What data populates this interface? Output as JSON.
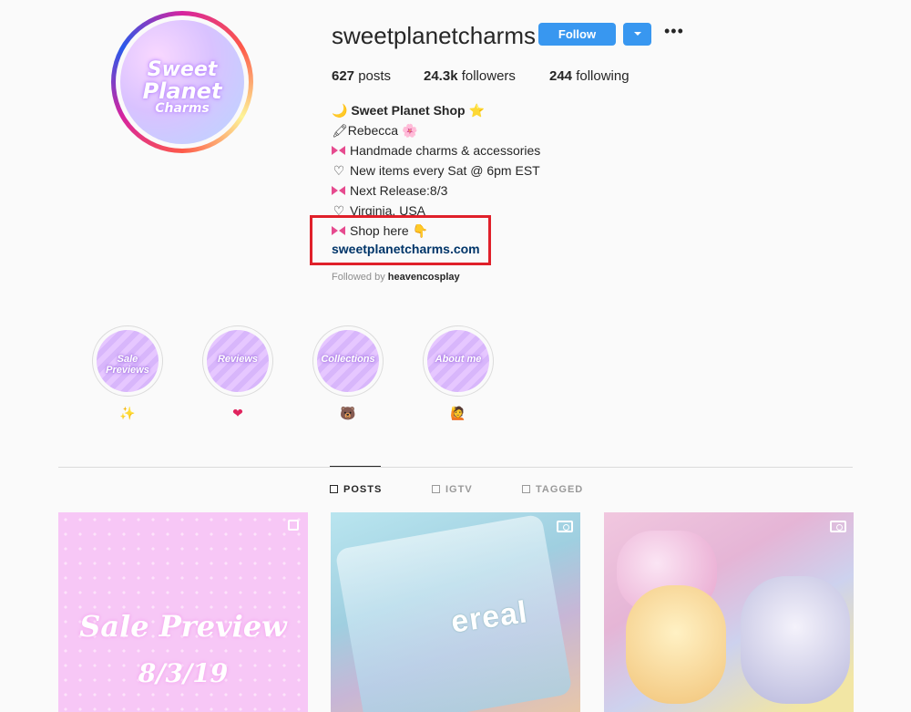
{
  "profile": {
    "username": "sweetplanetcharms",
    "follow_label": "Follow",
    "avatar_text": [
      "Sweet",
      "Planet",
      "Charms"
    ],
    "stats": {
      "posts_count": "627",
      "posts_label": "posts",
      "followers_count": "24.3k",
      "followers_label": "followers",
      "following_count": "244",
      "following_label": "following"
    }
  },
  "bio": {
    "name": "Sweet Planet Shop",
    "name_prefix_icon": "🌙",
    "name_suffix_icon": "⭐",
    "lines": [
      {
        "icon": "🖍",
        "text": "Rebecca",
        "suffix": "🌸"
      },
      {
        "icon": "ribbon",
        "text": "Handmade charms & accessories"
      },
      {
        "icon": "♡",
        "text": "New items every Sat @ 6pm EST"
      },
      {
        "icon": "ribbon",
        "text": "Next Release:8/3"
      },
      {
        "icon": "♡",
        "text": "Virginia, USA"
      },
      {
        "icon": "ribbon",
        "text": "Shop here",
        "suffix": "👇"
      }
    ],
    "link": "sweetplanetcharms.com",
    "followed_by_prefix": "Followed by",
    "followed_by_user": "heavencosplay"
  },
  "highlights": [
    {
      "label": "Sale Previews",
      "emoji": "✨"
    },
    {
      "label": "Reviews",
      "emoji": "❤"
    },
    {
      "label": "Collections",
      "emoji": "🐻"
    },
    {
      "label": "About me",
      "emoji": "🙋"
    }
  ],
  "tabs": [
    {
      "label": "POSTS",
      "icon": "grid-icon",
      "active": true
    },
    {
      "label": "IGTV",
      "icon": "tv-icon",
      "active": false
    },
    {
      "label": "TAGGED",
      "icon": "tag-icon",
      "active": false
    }
  ],
  "posts": [
    {
      "title": "Sale Preview",
      "date": "8/3/19",
      "corner_icon": "carousel-icon"
    },
    {
      "overlay_text": "ereal",
      "corner_icon": "video-icon"
    },
    {
      "corner_icon": "video-icon"
    }
  ],
  "colors": {
    "accent": "#3897f0",
    "link": "#003569",
    "highlight_border": "#e0202a"
  }
}
